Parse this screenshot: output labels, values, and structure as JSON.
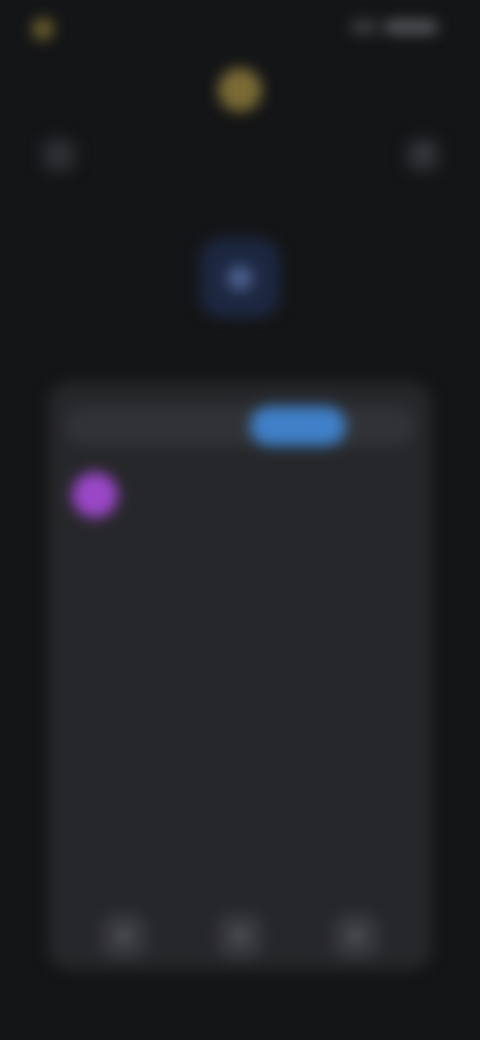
{
  "status_bar": {
    "left_text": "",
    "time": ""
  },
  "nav": {
    "left_label": "",
    "right_label": "",
    "left_icon": "back-icon",
    "right_icon": "menu-icon"
  },
  "hero": {
    "name": ""
  },
  "tabs": [
    {
      "label": ""
    },
    {
      "label": ""
    },
    {
      "label": ""
    }
  ],
  "contact": {
    "name": "",
    "subtitle": ""
  },
  "list_items": [
    {
      "label": ""
    },
    {
      "label": ""
    },
    {
      "label": ""
    },
    {
      "label": ""
    },
    {
      "label": ""
    }
  ],
  "section": {
    "label": ""
  },
  "actions": [
    {
      "icon": "circle-icon"
    },
    {
      "icon": "circle-icon"
    },
    {
      "icon": "circle-icon"
    }
  ],
  "colors": {
    "background": "#141517",
    "card": "#26272a",
    "accent": "#3f80c8",
    "contact_avatar": "#9a47c7",
    "brand_logo": "#7b6b35"
  }
}
